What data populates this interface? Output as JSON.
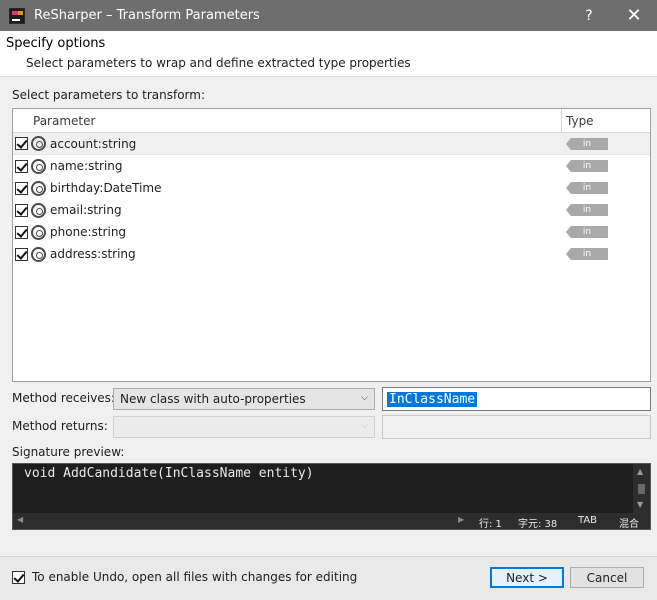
{
  "window": {
    "title": "ReSharper – Transform Parameters",
    "help": "?",
    "close": "✕"
  },
  "header": {
    "title": "Specify options",
    "subtitle": "Select parameters to wrap and define extracted type properties"
  },
  "parameters_label": "Select parameters to transform:",
  "table": {
    "columns": [
      "Parameter",
      "Type"
    ],
    "rows": [
      {
        "name": "account:string",
        "type": "in",
        "checked": true
      },
      {
        "name": "name:string",
        "type": "in",
        "checked": true
      },
      {
        "name": "birthday:DateTime",
        "type": "in",
        "checked": true
      },
      {
        "name": "email:string",
        "type": "in",
        "checked": true
      },
      {
        "name": "phone:string",
        "type": "in",
        "checked": true
      },
      {
        "name": "address:string",
        "type": "in",
        "checked": true
      }
    ]
  },
  "method_receives": {
    "label": "Method receives:",
    "value": "New class with auto-properties",
    "class_name": "InClassName"
  },
  "method_returns": {
    "label": "Method returns:",
    "value": "",
    "class_name": ""
  },
  "signature": {
    "label": "Signature preview:",
    "code": "void AddCandidate(InClassName entity)",
    "status_line": "行: 1",
    "status_char": "字元: 38",
    "status_tab": "TAB",
    "status_mode": "混合"
  },
  "footer": {
    "undo_label": "To enable Undo, open all files with changes for editing",
    "undo_checked": true,
    "next_label": "Next >",
    "cancel_label": "Cancel"
  },
  "colors": {
    "titlebar": "#6e6e6e",
    "accent": "#0078d7",
    "editor_bg": "#1e1e1e",
    "badge": "#a9a9a9"
  }
}
